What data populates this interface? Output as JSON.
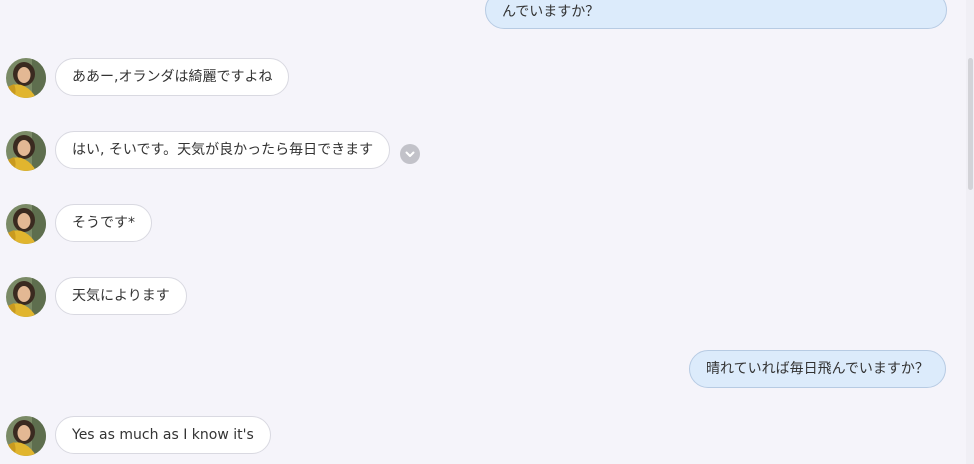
{
  "messages": [
    {
      "id": "m0",
      "side": "out",
      "text": "んでいますか？"
    },
    {
      "id": "m1",
      "side": "in",
      "text": "ああー,オランダは綺麗ですよね"
    },
    {
      "id": "m2",
      "side": "in",
      "text": "はい, そいです。天気が良かったら毎日できます"
    },
    {
      "id": "m3",
      "side": "in",
      "text": "そうです*"
    },
    {
      "id": "m4",
      "side": "in",
      "text": "天気によります"
    },
    {
      "id": "m5",
      "side": "out",
      "text": "晴れていれば毎日飛んでいますか？"
    },
    {
      "id": "m6",
      "side": "in",
      "text": "Yes as much as I know it's"
    }
  ],
  "icons": {
    "avatar": "user-avatar-photo",
    "reaction": "chevron-down-icon"
  },
  "colors": {
    "background": "#f5f4fa",
    "incoming_bubble": "#ffffff",
    "outgoing_bubble": "#dcebfb",
    "outgoing_border": "#b7cbe3"
  }
}
